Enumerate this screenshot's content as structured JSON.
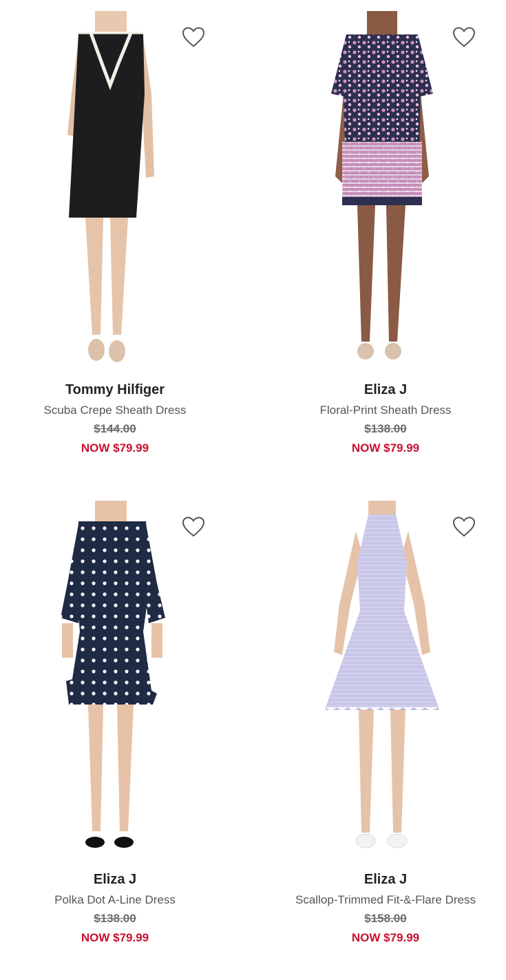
{
  "colors": {
    "sale_price": "#c8102e",
    "brand_text": "#222222",
    "name_text": "#555555",
    "original_price": "#6b6b6b"
  },
  "icons": {
    "wishlist": "heart-outline-icon"
  },
  "products": [
    {
      "brand": "Tommy Hilfiger",
      "name": "Scuba Crepe Sheath Dress",
      "original_price": "$144.00",
      "sale_price": "NOW $79.99",
      "image_alt": "black sleeveless sheath dress with white trim neckline"
    },
    {
      "brand": "Eliza J",
      "name": "Floral-Print Sheath Dress",
      "original_price": "$138.00",
      "sale_price": "NOW $79.99",
      "image_alt": "navy and pink floral print elbow-sleeve sheath dress"
    },
    {
      "brand": "Eliza J",
      "name": "Polka Dot A-Line Dress",
      "original_price": "$138.00",
      "sale_price": "NOW $79.99",
      "image_alt": "navy polka dot dress with ruffle sleeves and hem"
    },
    {
      "brand": "Eliza J",
      "name": "Scallop-Trimmed Fit-&-Flare Dress",
      "original_price": "$158.00",
      "sale_price": "NOW $79.99",
      "image_alt": "lavender halter fit-and-flare dress with scalloped hem"
    }
  ]
}
